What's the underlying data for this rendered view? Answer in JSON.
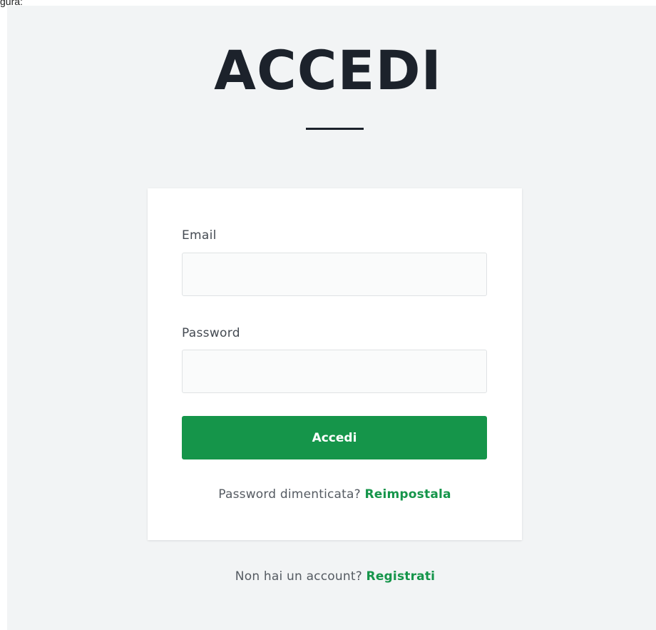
{
  "top_label": "gura:",
  "title": "ACCEDI",
  "form": {
    "email_label": "Email",
    "email_value": "",
    "password_label": "Password",
    "password_value": "",
    "submit_label": "Accedi"
  },
  "forgot": {
    "prompt": "Password dimenticata?",
    "link": "Reimpostala"
  },
  "signup": {
    "prompt": "Non hai un account?",
    "link": "Registrati"
  },
  "colors": {
    "background": "#f2f4f5",
    "accent_green": "#15954a",
    "title_text": "#1c222b"
  }
}
